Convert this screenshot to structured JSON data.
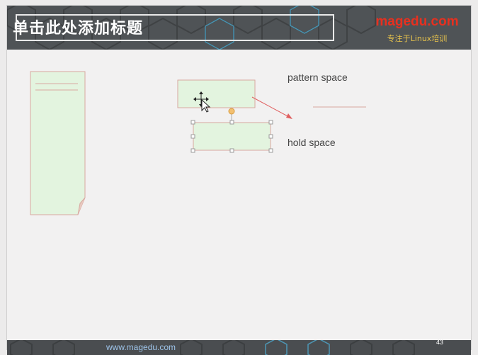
{
  "slide": {
    "title": "单击此处添加标题",
    "brand_logo": "magedu.com",
    "brand_tagline": "专注于Linux培训",
    "footer_url": "www.magedu.com",
    "page_number": "43"
  },
  "diagram": {
    "pattern_space_label": "pattern space",
    "hold_space_label": "hold space"
  },
  "colors": {
    "header_bg": "#4f5356",
    "brand_red": "#e8301f",
    "box_fill": "#e3f4df",
    "box_border": "#d8a8a0",
    "arrow": "#e06060"
  }
}
